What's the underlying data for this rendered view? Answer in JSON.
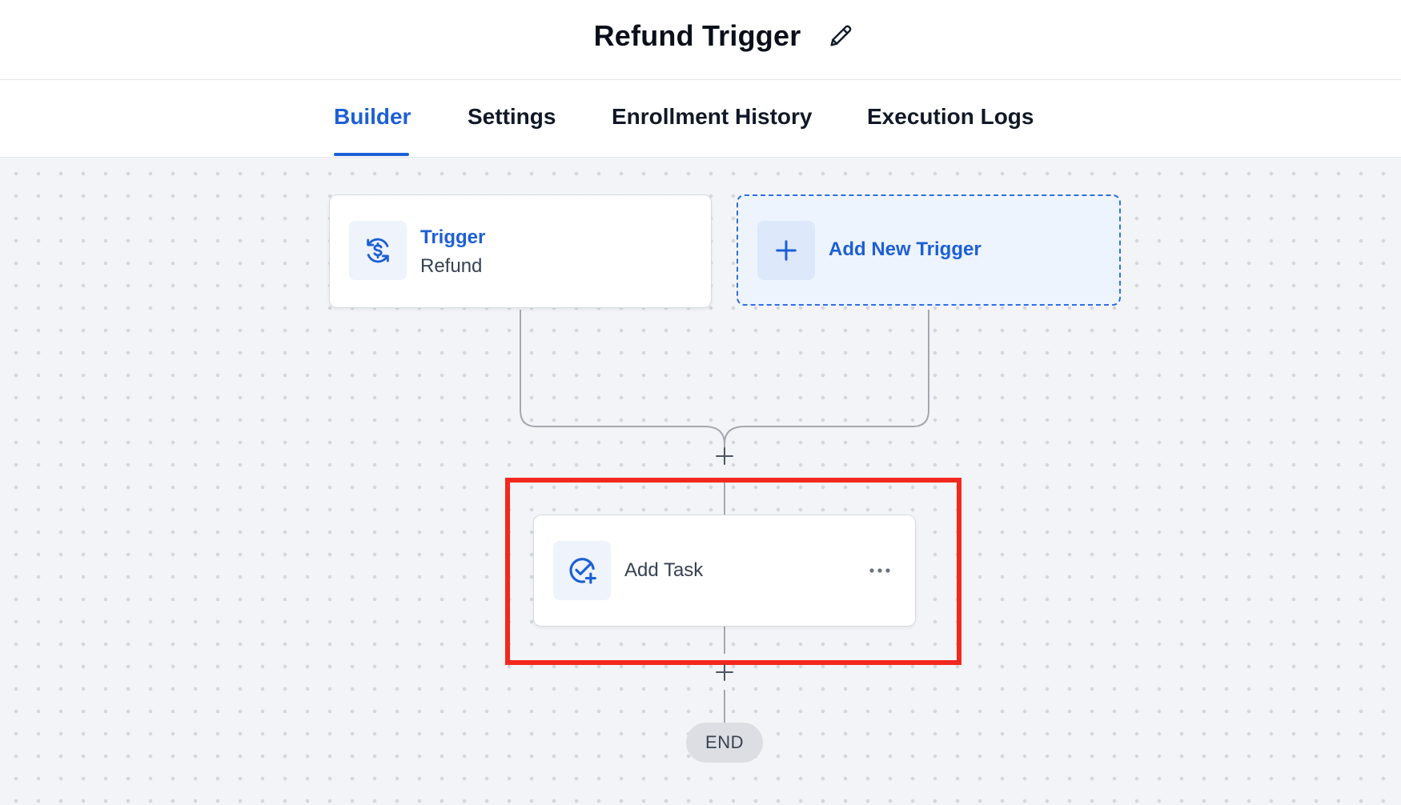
{
  "header": {
    "title": "Refund Trigger",
    "edit_icon": "pencil-icon"
  },
  "tabs": [
    {
      "label": "Builder",
      "active": true
    },
    {
      "label": "Settings",
      "active": false
    },
    {
      "label": "Enrollment History",
      "active": false
    },
    {
      "label": "Execution Logs",
      "active": false
    }
  ],
  "workflow": {
    "trigger": {
      "label": "Trigger",
      "value": "Refund",
      "icon": "refund-dollar-icon"
    },
    "add_trigger": {
      "label": "Add New Trigger",
      "icon": "plus-icon"
    },
    "task": {
      "label": "Add Task",
      "icon": "task-check-plus-icon",
      "menu_icon": "more-horizontal-icon",
      "highlighted": true
    },
    "end": {
      "label": "END"
    }
  },
  "colors": {
    "accent": "#1d5fd6",
    "highlight": "#f2281f",
    "canvas_bg": "#f3f4f7",
    "connector": "#a3a7af"
  }
}
